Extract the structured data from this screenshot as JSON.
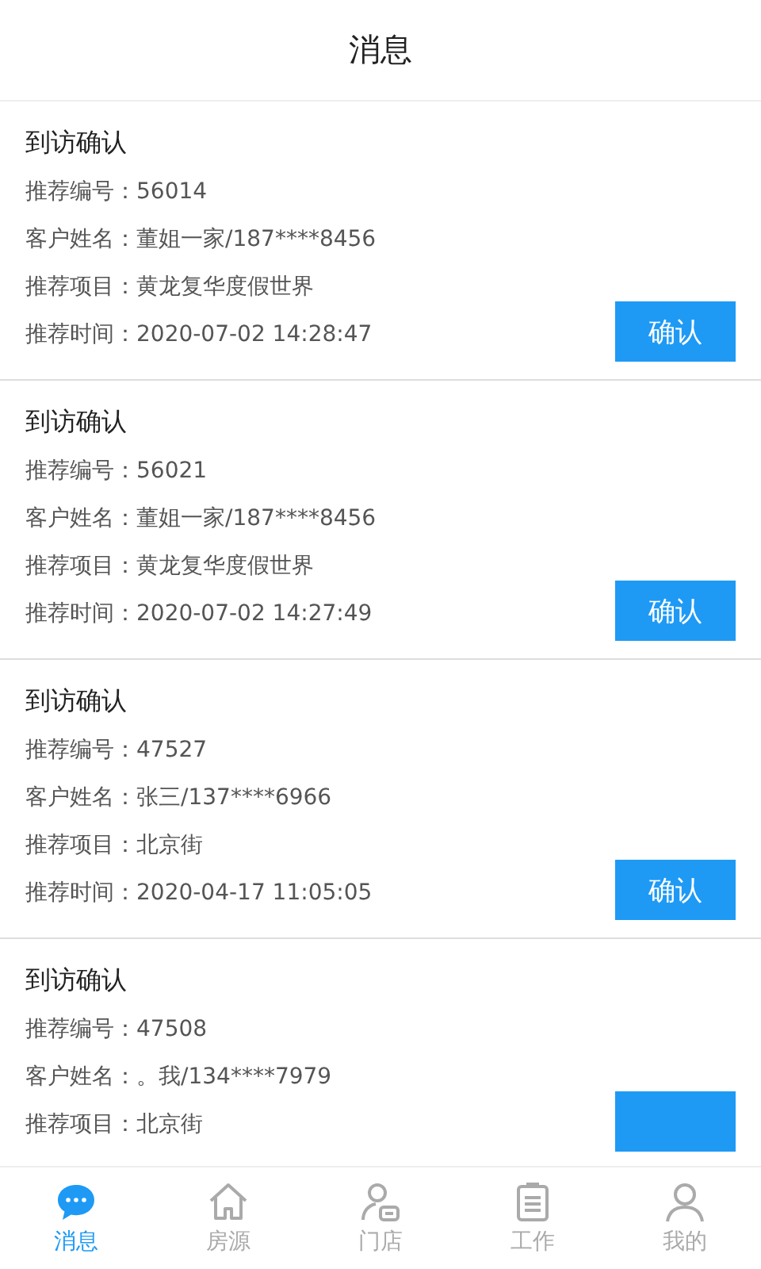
{
  "header": {
    "title": "消息"
  },
  "messages": [
    {
      "title": "到访确认",
      "fields": [
        {
          "label": "推荐编号：",
          "value": "56014"
        },
        {
          "label": "客户姓名：",
          "value": "董姐一家/187****8456"
        },
        {
          "label": "推荐项目：",
          "value": "黄龙复华度假世界"
        },
        {
          "label": "推荐时间：",
          "value": "2020-07-02 14:28:47"
        }
      ],
      "button": {
        "label": "确认"
      }
    },
    {
      "title": "到访确认",
      "fields": [
        {
          "label": "推荐编号：",
          "value": "56021"
        },
        {
          "label": "客户姓名：",
          "value": "董姐一家/187****8456"
        },
        {
          "label": "推荐项目：",
          "value": "黄龙复华度假世界"
        },
        {
          "label": "推荐时间：",
          "value": "2020-07-02 14:27:49"
        }
      ],
      "button": {
        "label": "确认"
      }
    },
    {
      "title": "到访确认",
      "fields": [
        {
          "label": "推荐编号：",
          "value": "47527"
        },
        {
          "label": "客户姓名：",
          "value": "张三/137****6966"
        },
        {
          "label": "推荐项目：",
          "value": "北京街"
        },
        {
          "label": "推荐时间：",
          "value": "2020-04-17 11:05:05"
        }
      ],
      "button": {
        "label": "确认"
      }
    },
    {
      "title": "到访确认",
      "fields": [
        {
          "label": "推荐编号：",
          "value": "47508"
        },
        {
          "label": "客户姓名：",
          "value": "。我/134****7979"
        },
        {
          "label": "推荐项目：",
          "value": "北京街"
        }
      ],
      "button": {
        "clipped": true
      }
    }
  ],
  "tabs": [
    {
      "label": "消息",
      "selected": true
    },
    {
      "label": "房源",
      "selected": false
    },
    {
      "label": "门店",
      "selected": false
    },
    {
      "label": "工作",
      "selected": false
    },
    {
      "label": "我的",
      "selected": false
    }
  ]
}
